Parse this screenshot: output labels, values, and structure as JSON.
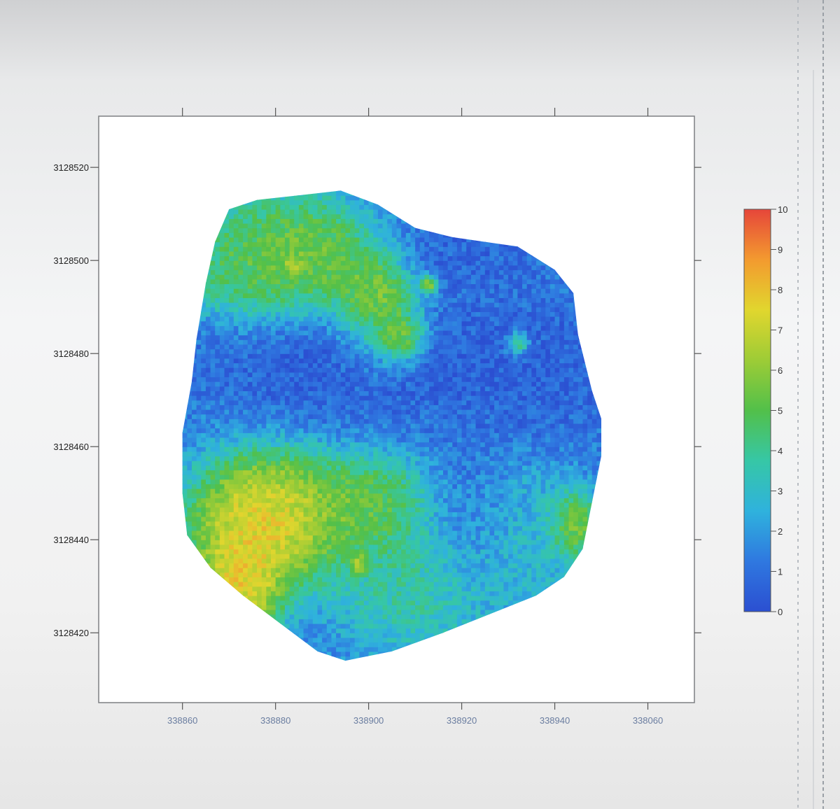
{
  "chart_data": {
    "type": "heatmap",
    "title": "",
    "xlabel": "",
    "ylabel": "",
    "xlim": [
      338842,
      338070
    ],
    "x_range": [
      338842,
      338070
    ],
    "ylim": [
      3128405,
      3128531
    ],
    "x_ticks": [
      338860,
      338880,
      338900,
      338920,
      338940,
      338960
    ],
    "x_tick_labels": [
      "338860",
      "338880",
      "338900",
      "338920",
      "338940",
      "338060"
    ],
    "y_ticks": [
      3128520,
      3128500,
      3128480,
      3128460,
      3128440,
      3128420
    ],
    "y_tick_labels": [
      "3128520",
      "3128500",
      "3128480",
      "3128460",
      "3128440",
      "3128420"
    ],
    "colorbar": {
      "min": 0,
      "max": 10,
      "ticks": [
        "0",
        "1",
        "2",
        "3",
        "4",
        "5",
        "6",
        "7",
        "8",
        "9",
        "10"
      ],
      "colormap": "jet",
      "colors": [
        "#2b4fd1",
        "#2f78e0",
        "#2fb2dd",
        "#36c7a6",
        "#52c04a",
        "#9dcc36",
        "#e1d62e",
        "#f39a2f",
        "#e6463a"
      ]
    },
    "grid": false,
    "legend": "colorbar right",
    "value_field": {
      "boundary": [
        [
          338870,
          3128511
        ],
        [
          338876,
          3128513
        ],
        [
          338885,
          3128514
        ],
        [
          338894,
          3128515
        ],
        [
          338902,
          3128512
        ],
        [
          338910,
          3128507
        ],
        [
          338918,
          3128505
        ],
        [
          338925,
          3128504
        ],
        [
          338932,
          3128503
        ],
        [
          338940,
          3128498
        ],
        [
          338944,
          3128493
        ],
        [
          338945,
          3128484
        ],
        [
          338948,
          3128472
        ],
        [
          338950,
          3128466
        ],
        [
          338950,
          3128458
        ],
        [
          338948,
          3128448
        ],
        [
          338946,
          3128438
        ],
        [
          338942,
          3128432
        ],
        [
          338936,
          3128428
        ],
        [
          338926,
          3128424
        ],
        [
          338916,
          3128420
        ],
        [
          338905,
          3128416
        ],
        [
          338895,
          3128414
        ],
        [
          338889,
          3128416
        ],
        [
          338881,
          3128422
        ],
        [
          338873,
          3128428
        ],
        [
          338866,
          3128434
        ],
        [
          338861,
          3128441
        ],
        [
          338860,
          3128450
        ],
        [
          338860,
          3128463
        ],
        [
          338862,
          3128474
        ],
        [
          338863,
          3128483
        ],
        [
          338865,
          3128495
        ],
        [
          338867,
          3128504
        ]
      ],
      "background_value": 1.5,
      "features": [
        {
          "x": 338900,
          "y": 3128478,
          "sx": 21,
          "sy": 7,
          "value": 0.2
        },
        {
          "x": 338936,
          "y": 3128477,
          "sx": 11,
          "sy": 9,
          "value": 0.4
        },
        {
          "x": 338921,
          "y": 3128444,
          "sx": 6,
          "sy": 9,
          "value": 0.5
        },
        {
          "x": 338920,
          "y": 3128502,
          "sx": 9,
          "sy": 6,
          "value": 0.5
        },
        {
          "x": 338878,
          "y": 3128444,
          "sx": 9,
          "sy": 8,
          "value": 9.6
        },
        {
          "x": 338872,
          "y": 3128430,
          "sx": 5,
          "sy": 6,
          "value": 9.3
        },
        {
          "x": 338887,
          "y": 3128501,
          "sx": 8,
          "sy": 7,
          "value": 6.6
        },
        {
          "x": 338902,
          "y": 3128490,
          "sx": 5,
          "sy": 7,
          "value": 7.8
        },
        {
          "x": 338907,
          "y": 3128483,
          "sx": 3,
          "sy": 3,
          "value": 9.4
        },
        {
          "x": 338874,
          "y": 3128500,
          "sx": 8,
          "sy": 7,
          "value": 5.8
        },
        {
          "x": 338899,
          "y": 3128447,
          "sx": 9,
          "sy": 6,
          "value": 6.4
        },
        {
          "x": 338932,
          "y": 3128440,
          "sx": 9,
          "sy": 9,
          "value": 3.3
        },
        {
          "x": 338910,
          "y": 3128432,
          "sx": 10,
          "sy": 9,
          "value": 4.6
        },
        {
          "x": 338944,
          "y": 3128443,
          "sx": 3,
          "sy": 4,
          "value": 7.5
        },
        {
          "x": 338932,
          "y": 3128482,
          "sx": 1.5,
          "sy": 1.5,
          "value": 8.5
        },
        {
          "x": 338884,
          "y": 3128499,
          "sx": 1.2,
          "sy": 1.2,
          "value": 9.2
        },
        {
          "x": 338913,
          "y": 3128495,
          "sx": 1.2,
          "sy": 1.2,
          "value": 9.0
        },
        {
          "x": 338898,
          "y": 3128435,
          "sx": 1.2,
          "sy": 1.2,
          "value": 9.0
        }
      ]
    }
  }
}
